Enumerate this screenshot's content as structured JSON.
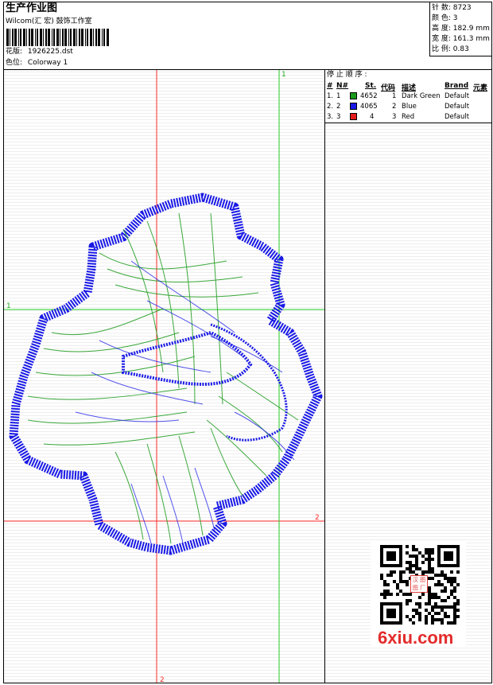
{
  "header": {
    "title": "生产作业图",
    "studio": "Wilcom(汇 宏) 鼓饰工作室",
    "design_label": "花版:",
    "design_value": "1926225.dst",
    "color_label": "色位:",
    "color_value": "Colorway 1"
  },
  "stats": {
    "stitches": "针 数: 8723",
    "colors": "颜 色: 3",
    "height": "高 度: 182.9 mm",
    "width": "宽 度: 161.3 mm",
    "scale": "比 例: 0.83"
  },
  "canvas": {
    "guide_label_top": "1",
    "guide_label_left": "1",
    "guide_label_right": "2",
    "guide_label_bottom": "2"
  },
  "stop_table": {
    "heading": "停 止 顺 序 :",
    "columns": [
      "#",
      "N#",
      "St.",
      "代码",
      "描述",
      "Brand",
      "元素"
    ],
    "rows": [
      {
        "idx": "1.",
        "n": "1",
        "st": "4652",
        "code": "1",
        "desc": "Dark Green",
        "brand": "Default",
        "color": "#1a9a1a"
      },
      {
        "idx": "2.",
        "n": "2",
        "st": "4065",
        "code": "2",
        "desc": "Blue",
        "brand": "Default",
        "color": "#1a1ae6"
      },
      {
        "idx": "3.",
        "n": "3",
        "st": "4",
        "code": "3",
        "desc": "Red",
        "brand": "Default",
        "color": "#e61a1a"
      }
    ]
  },
  "watermark": {
    "text": "6xiu.com",
    "stamp": "汉 图 图 厂"
  }
}
